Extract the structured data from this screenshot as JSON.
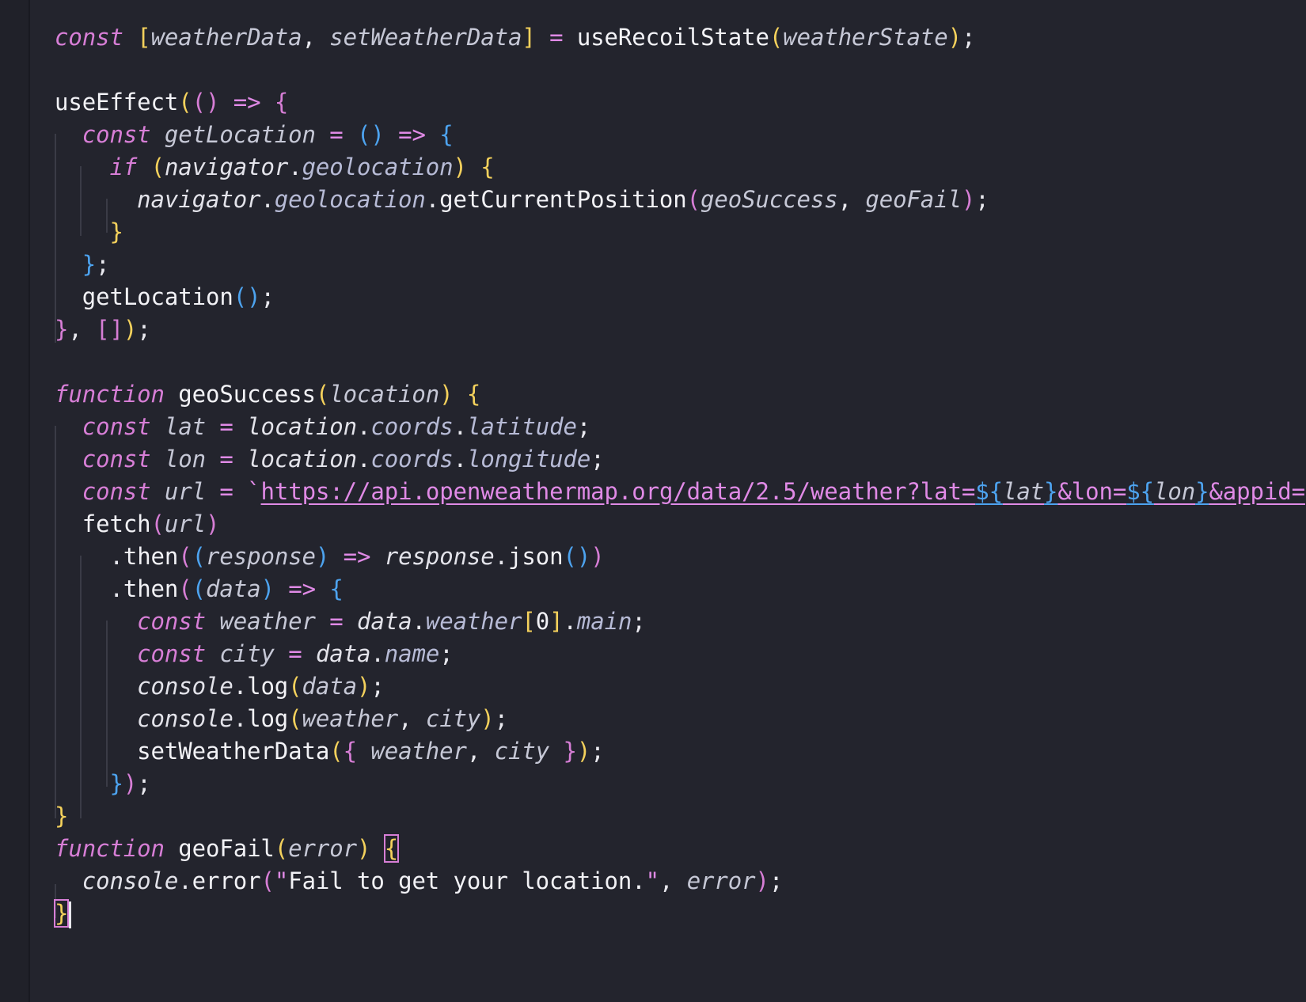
{
  "editor": {
    "language": "javascript",
    "theme_background": "#23242d",
    "cursor_line": 27,
    "lines": [
      "const [weatherData, setWeatherData] = useRecoilState(weatherState);",
      "",
      "useEffect(() => {",
      "  const getLocation = () => {",
      "    if (navigator.geolocation) {",
      "      navigator.geolocation.getCurrentPosition(geoSuccess, geoFail);",
      "    }",
      "  };",
      "  getLocation();",
      "}, []);",
      "",
      "function geoSuccess(location) {",
      "  const lat = location.coords.latitude;",
      "  const lon = location.coords.longitude;",
      "  const url = `https://api.openweathermap.org/data/2.5/weather?lat=${lat}&lon=${lon}&appid=",
      "  fetch(url)",
      "    .then((response) => response.json())",
      "    .then((data) => {",
      "      const weather = data.weather[0].main;",
      "      const city = data.name;",
      "      console.log(data);",
      "      console.log(weather, city);",
      "      setWeatherData({ weather, city });",
      "    });",
      "}",
      "function geoFail(error) {",
      "  console.error(\"Fail to get your location.\", error);",
      "}"
    ]
  }
}
